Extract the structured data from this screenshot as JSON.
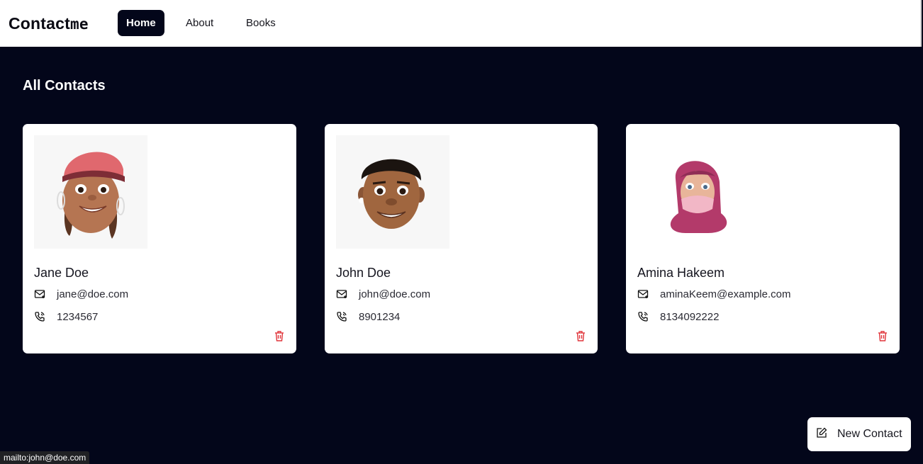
{
  "nav": {
    "brand_main": "Contact",
    "brand_suffix": "me",
    "links": [
      "Home",
      "About",
      "Books"
    ],
    "active": "Home"
  },
  "main": {
    "title": "All Contacts"
  },
  "contacts": [
    {
      "name": "Jane Doe",
      "email": "jane@doe.com",
      "phone": "1234567"
    },
    {
      "name": "John Doe",
      "email": "john@doe.com",
      "phone": "8901234"
    },
    {
      "name": "Amina Hakeem",
      "email": "aminaKeem@example.com",
      "phone": "8134092222"
    }
  ],
  "icons": {
    "email": "mail-icon",
    "phone": "phone-icon",
    "delete": "trash-icon",
    "new_contact": "edit-icon"
  },
  "actions": {
    "new_contact_label": "New Contact"
  },
  "status_bar": {
    "link_preview": "mailto:john@doe.com"
  },
  "colors": {
    "background": "#03061a",
    "card": "#ffffff",
    "delete": "#e0353b"
  }
}
